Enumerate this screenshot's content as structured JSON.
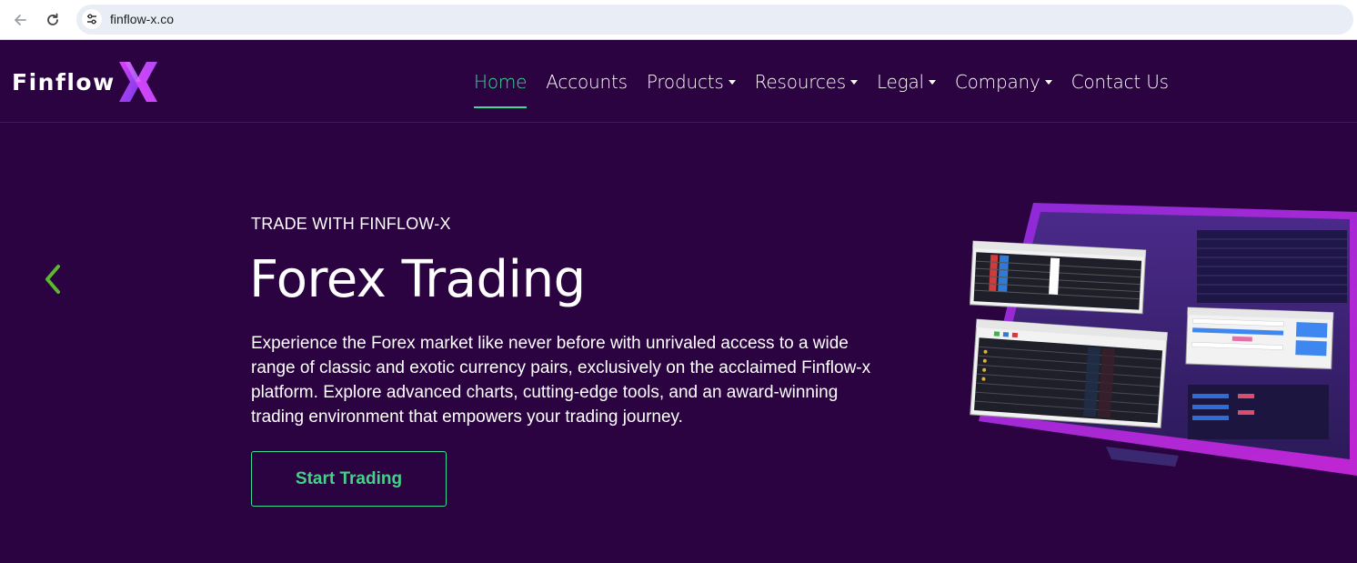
{
  "browser": {
    "url": "finflow-x.co"
  },
  "header": {
    "logo_text": "Finflow",
    "nav": [
      {
        "label": "Home",
        "active": true,
        "dropdown": false
      },
      {
        "label": "Accounts",
        "active": false,
        "dropdown": false
      },
      {
        "label": "Products",
        "active": false,
        "dropdown": true
      },
      {
        "label": "Resources",
        "active": false,
        "dropdown": true
      },
      {
        "label": "Legal",
        "active": false,
        "dropdown": true
      },
      {
        "label": "Company",
        "active": false,
        "dropdown": true
      },
      {
        "label": "Contact Us",
        "active": false,
        "dropdown": false
      }
    ]
  },
  "hero": {
    "kicker": "TRADE WITH FINFLOW-X",
    "title": "Forex Trading",
    "description": "Experience the Forex market like never before with unrivaled access to a wide range of classic and exotic currency pairs, exclusively on the acclaimed Finflow-x platform. Explore advanced charts, cutting-edge tools, and an award-winning trading environment that empowers your trading journey.",
    "cta_label": "Start Trading"
  },
  "colors": {
    "background": "#2a0340",
    "accent_green": "#3ddc97",
    "logo_gradient": [
      "#e040fb",
      "#7c4dff"
    ]
  },
  "icons": {
    "back": "arrow-left-icon",
    "reload": "reload-icon",
    "site_info": "tune-icon",
    "carousel_prev": "chevron-left-icon"
  }
}
